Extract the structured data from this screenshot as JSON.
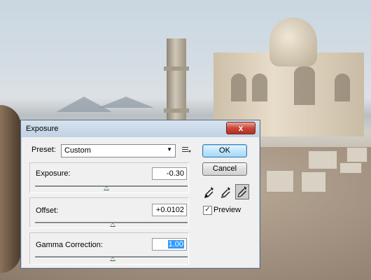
{
  "dialog": {
    "title": "Exposure",
    "close_glyph": "x",
    "preset_label": "Preset:",
    "preset_value": "Custom",
    "exposure_label": "Exposure:",
    "exposure_value": "-0.30",
    "exposure_slider_fraction": 0.47,
    "offset_label": "Offset:",
    "offset_value": "+0.0102",
    "offset_slider_fraction": 0.51,
    "gamma_label": "Gamma Correction:",
    "gamma_value": "1.00",
    "gamma_slider_fraction": 0.51,
    "ok_label": "OK",
    "cancel_label": "Cancel",
    "preview_label": "Preview",
    "preview_checked": true,
    "tools": [
      "black-point-eyedropper-icon",
      "gray-point-eyedropper-icon",
      "white-point-eyedropper-icon"
    ]
  },
  "colors": {
    "accent": "#3399ff",
    "close_red": "#c9463a",
    "slider_thumb": "#2f6b2f"
  }
}
